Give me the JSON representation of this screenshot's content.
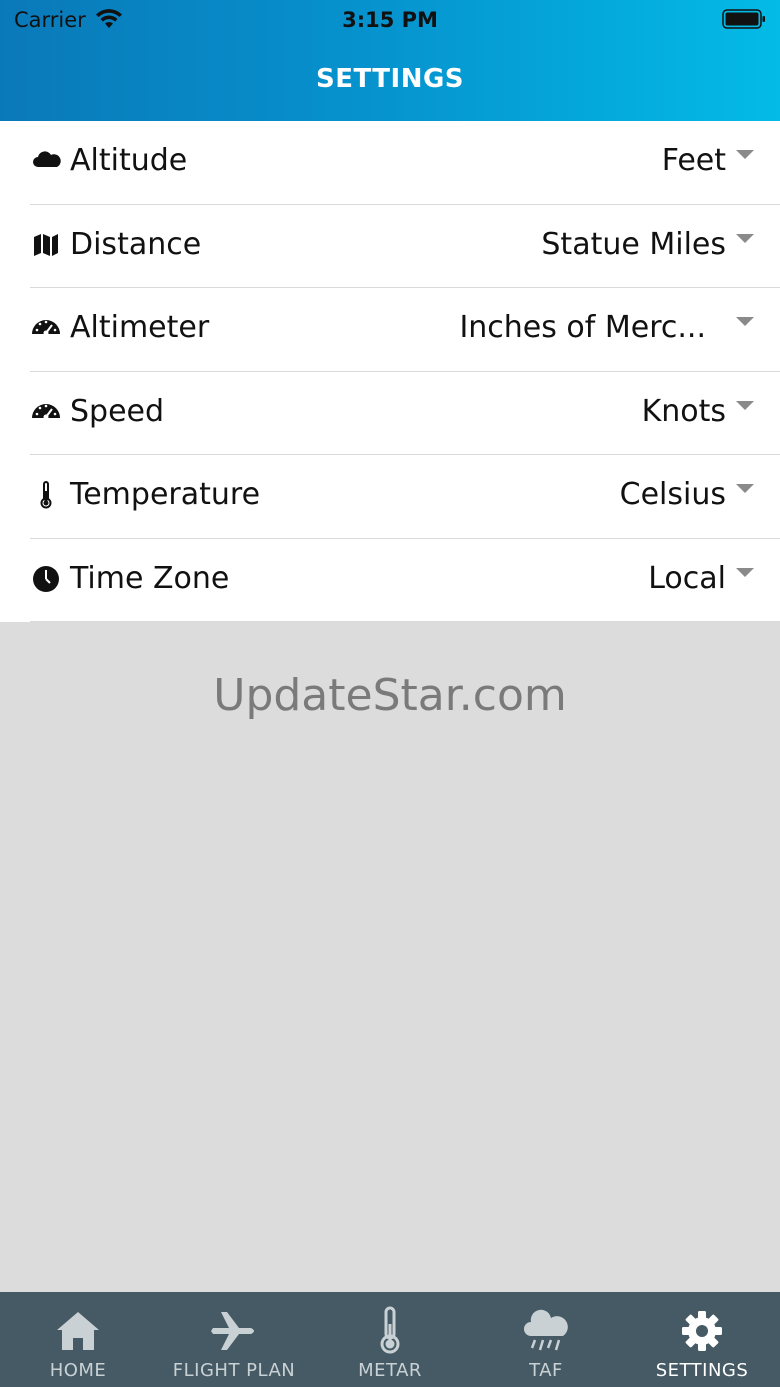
{
  "status_bar": {
    "carrier": "Carrier",
    "time": "3:15 PM"
  },
  "header": {
    "title": "SETTINGS",
    "gradient_colors": [
      "#0a79b9",
      "#03bbe6"
    ]
  },
  "settings": [
    {
      "label": "Altitude",
      "value": "Feet",
      "icon": "cloud-icon"
    },
    {
      "label": "Distance",
      "value": "Statue Miles",
      "icon": "map-icon"
    },
    {
      "label": "Altimeter",
      "value": "Inches of Merc...",
      "icon": "gauge-icon"
    },
    {
      "label": "Speed",
      "value": "Knots",
      "icon": "speedometer-icon"
    },
    {
      "label": "Temperature",
      "value": "Celsius",
      "icon": "thermometer-icon"
    },
    {
      "label": "Time Zone",
      "value": "Local",
      "icon": "clock-icon"
    }
  ],
  "watermark": "UpdateStar.com",
  "tabbar": {
    "background": "#455a64",
    "tabs": [
      {
        "label": "HOME",
        "icon": "home-icon"
      },
      {
        "label": "FLIGHT PLAN",
        "icon": "airplane-icon"
      },
      {
        "label": "METAR",
        "icon": "thermometer-icon"
      },
      {
        "label": "TAF",
        "icon": "rain-cloud-icon"
      },
      {
        "label": "SETTINGS",
        "icon": "gear-icon",
        "active": true
      }
    ]
  }
}
